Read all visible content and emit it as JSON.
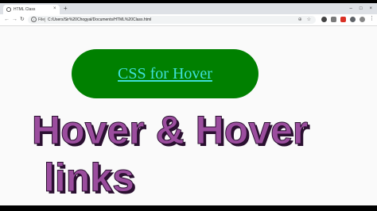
{
  "browser": {
    "tab": {
      "title": "HTML Class",
      "close_glyph": "×",
      "favicon": "globe-icon"
    },
    "new_tab_glyph": "+",
    "window_controls": [
      "–",
      "□",
      "×"
    ],
    "nav": {
      "back": "←",
      "forward": "→",
      "reload": "↻"
    },
    "address": {
      "info_glyph": "i",
      "label": "File",
      "url": "C:/Users/Sir%20Chogyal/Documents/HTML%20Class.html",
      "icons": [
        "⊕",
        "☆"
      ]
    },
    "extensions": [
      {
        "name": "circle-icon",
        "color": "#444444"
      },
      {
        "name": "extension-icon",
        "color": "#7a7a7a"
      },
      {
        "name": "record-icon",
        "color": "#d93025"
      },
      {
        "name": "extension-icon",
        "color": "#5f6368"
      },
      {
        "name": "extension-icon",
        "color": "#888888"
      }
    ],
    "menu_glyph": "⋮"
  },
  "page": {
    "button_label": "CSS for Hover",
    "button_color": "#008000",
    "button_text_color": "#3fe0d8",
    "heading_line1": "Hover & Hover",
    "heading_line2": "links",
    "heading_color": "#9b4d9e"
  }
}
